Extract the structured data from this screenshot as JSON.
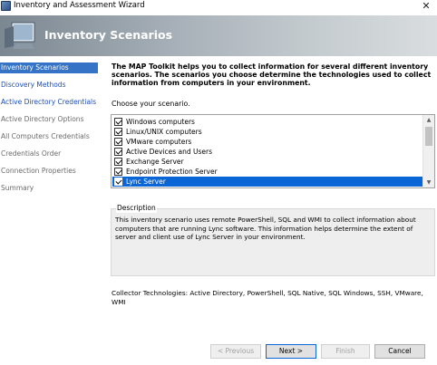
{
  "window": {
    "title": "Inventory and Assessment Wizard",
    "close_glyph": "✕"
  },
  "banner": {
    "title": "Inventory Scenarios"
  },
  "sidebar": {
    "items": [
      {
        "label": "Inventory Scenarios",
        "state": "active"
      },
      {
        "label": "Discovery Methods",
        "state": "link"
      },
      {
        "label": "Active Directory Credentials",
        "state": "link"
      },
      {
        "label": "Active Directory Options",
        "state": "normal"
      },
      {
        "label": "All Computers Credentials",
        "state": "normal"
      },
      {
        "label": "Credentials Order",
        "state": "normal"
      },
      {
        "label": "Connection Properties",
        "state": "normal"
      },
      {
        "label": "Summary",
        "state": "normal"
      }
    ]
  },
  "main": {
    "intro": "The MAP Toolkit helps you to collect information for several different inventory scenarios. The scenarios you choose determine the technologies used to collect information from computers in your environment.",
    "choose_label": "Choose your scenario.",
    "scenarios": [
      {
        "label": "Windows computers",
        "checked": true
      },
      {
        "label": "Linux/UNIX computers",
        "checked": true
      },
      {
        "label": "VMware computers",
        "checked": true
      },
      {
        "label": "Active Devices and Users",
        "checked": true
      },
      {
        "label": "Exchange Server",
        "checked": true
      },
      {
        "label": "Endpoint Protection Server",
        "checked": true
      },
      {
        "label": "Lync Server",
        "checked": true,
        "selected": true
      }
    ],
    "description_label": "Description",
    "description_text": "This inventory scenario uses remote PowerShell, SQL and WMI to collect information about computers that are running Lync software. This information helps determine the extent of server and client use of Lync Server in your environment.",
    "collector_text": "Collector Technologies: Active Directory, PowerShell, SQL Native, SQL Windows, SSH, VMware, WMI"
  },
  "buttons": {
    "previous": "< Previous",
    "next": "Next >",
    "finish": "Finish",
    "cancel": "Cancel"
  },
  "colors": {
    "selection": "#0a66d6",
    "nav_active": "#3473c6",
    "nav_link": "#1f4fb3"
  }
}
